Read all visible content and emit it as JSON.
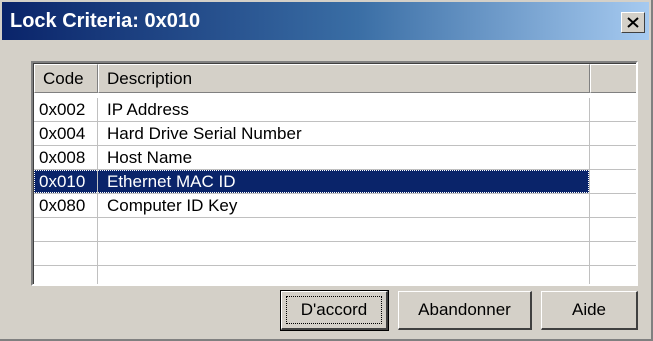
{
  "window": {
    "title": "Lock Criteria: 0x010",
    "close_symbol": "X"
  },
  "list": {
    "columns": [
      "Code",
      "Description"
    ],
    "rows": [
      {
        "code": "0x002",
        "description": "IP Address",
        "selected": false
      },
      {
        "code": "0x004",
        "description": "Hard Drive Serial Number",
        "selected": false
      },
      {
        "code": "0x008",
        "description": "Host Name",
        "selected": false
      },
      {
        "code": "0x010",
        "description": "Ethernet MAC ID",
        "selected": true
      },
      {
        "code": "0x080",
        "description": "Computer ID Key",
        "selected": false
      },
      {
        "code": "",
        "description": "",
        "selected": false
      },
      {
        "code": "",
        "description": "",
        "selected": false
      },
      {
        "code": "",
        "description": "",
        "selected": false
      }
    ]
  },
  "buttons": {
    "ok": "D'accord",
    "cancel": "Abandonner",
    "help": "Aide"
  },
  "colors": {
    "title_bar_start": "#0a246a",
    "title_bar_end": "#a6caf0",
    "selection": "#0a246a",
    "dialog_face": "#d4d0c8"
  },
  "icons": {
    "close": "close-icon"
  }
}
